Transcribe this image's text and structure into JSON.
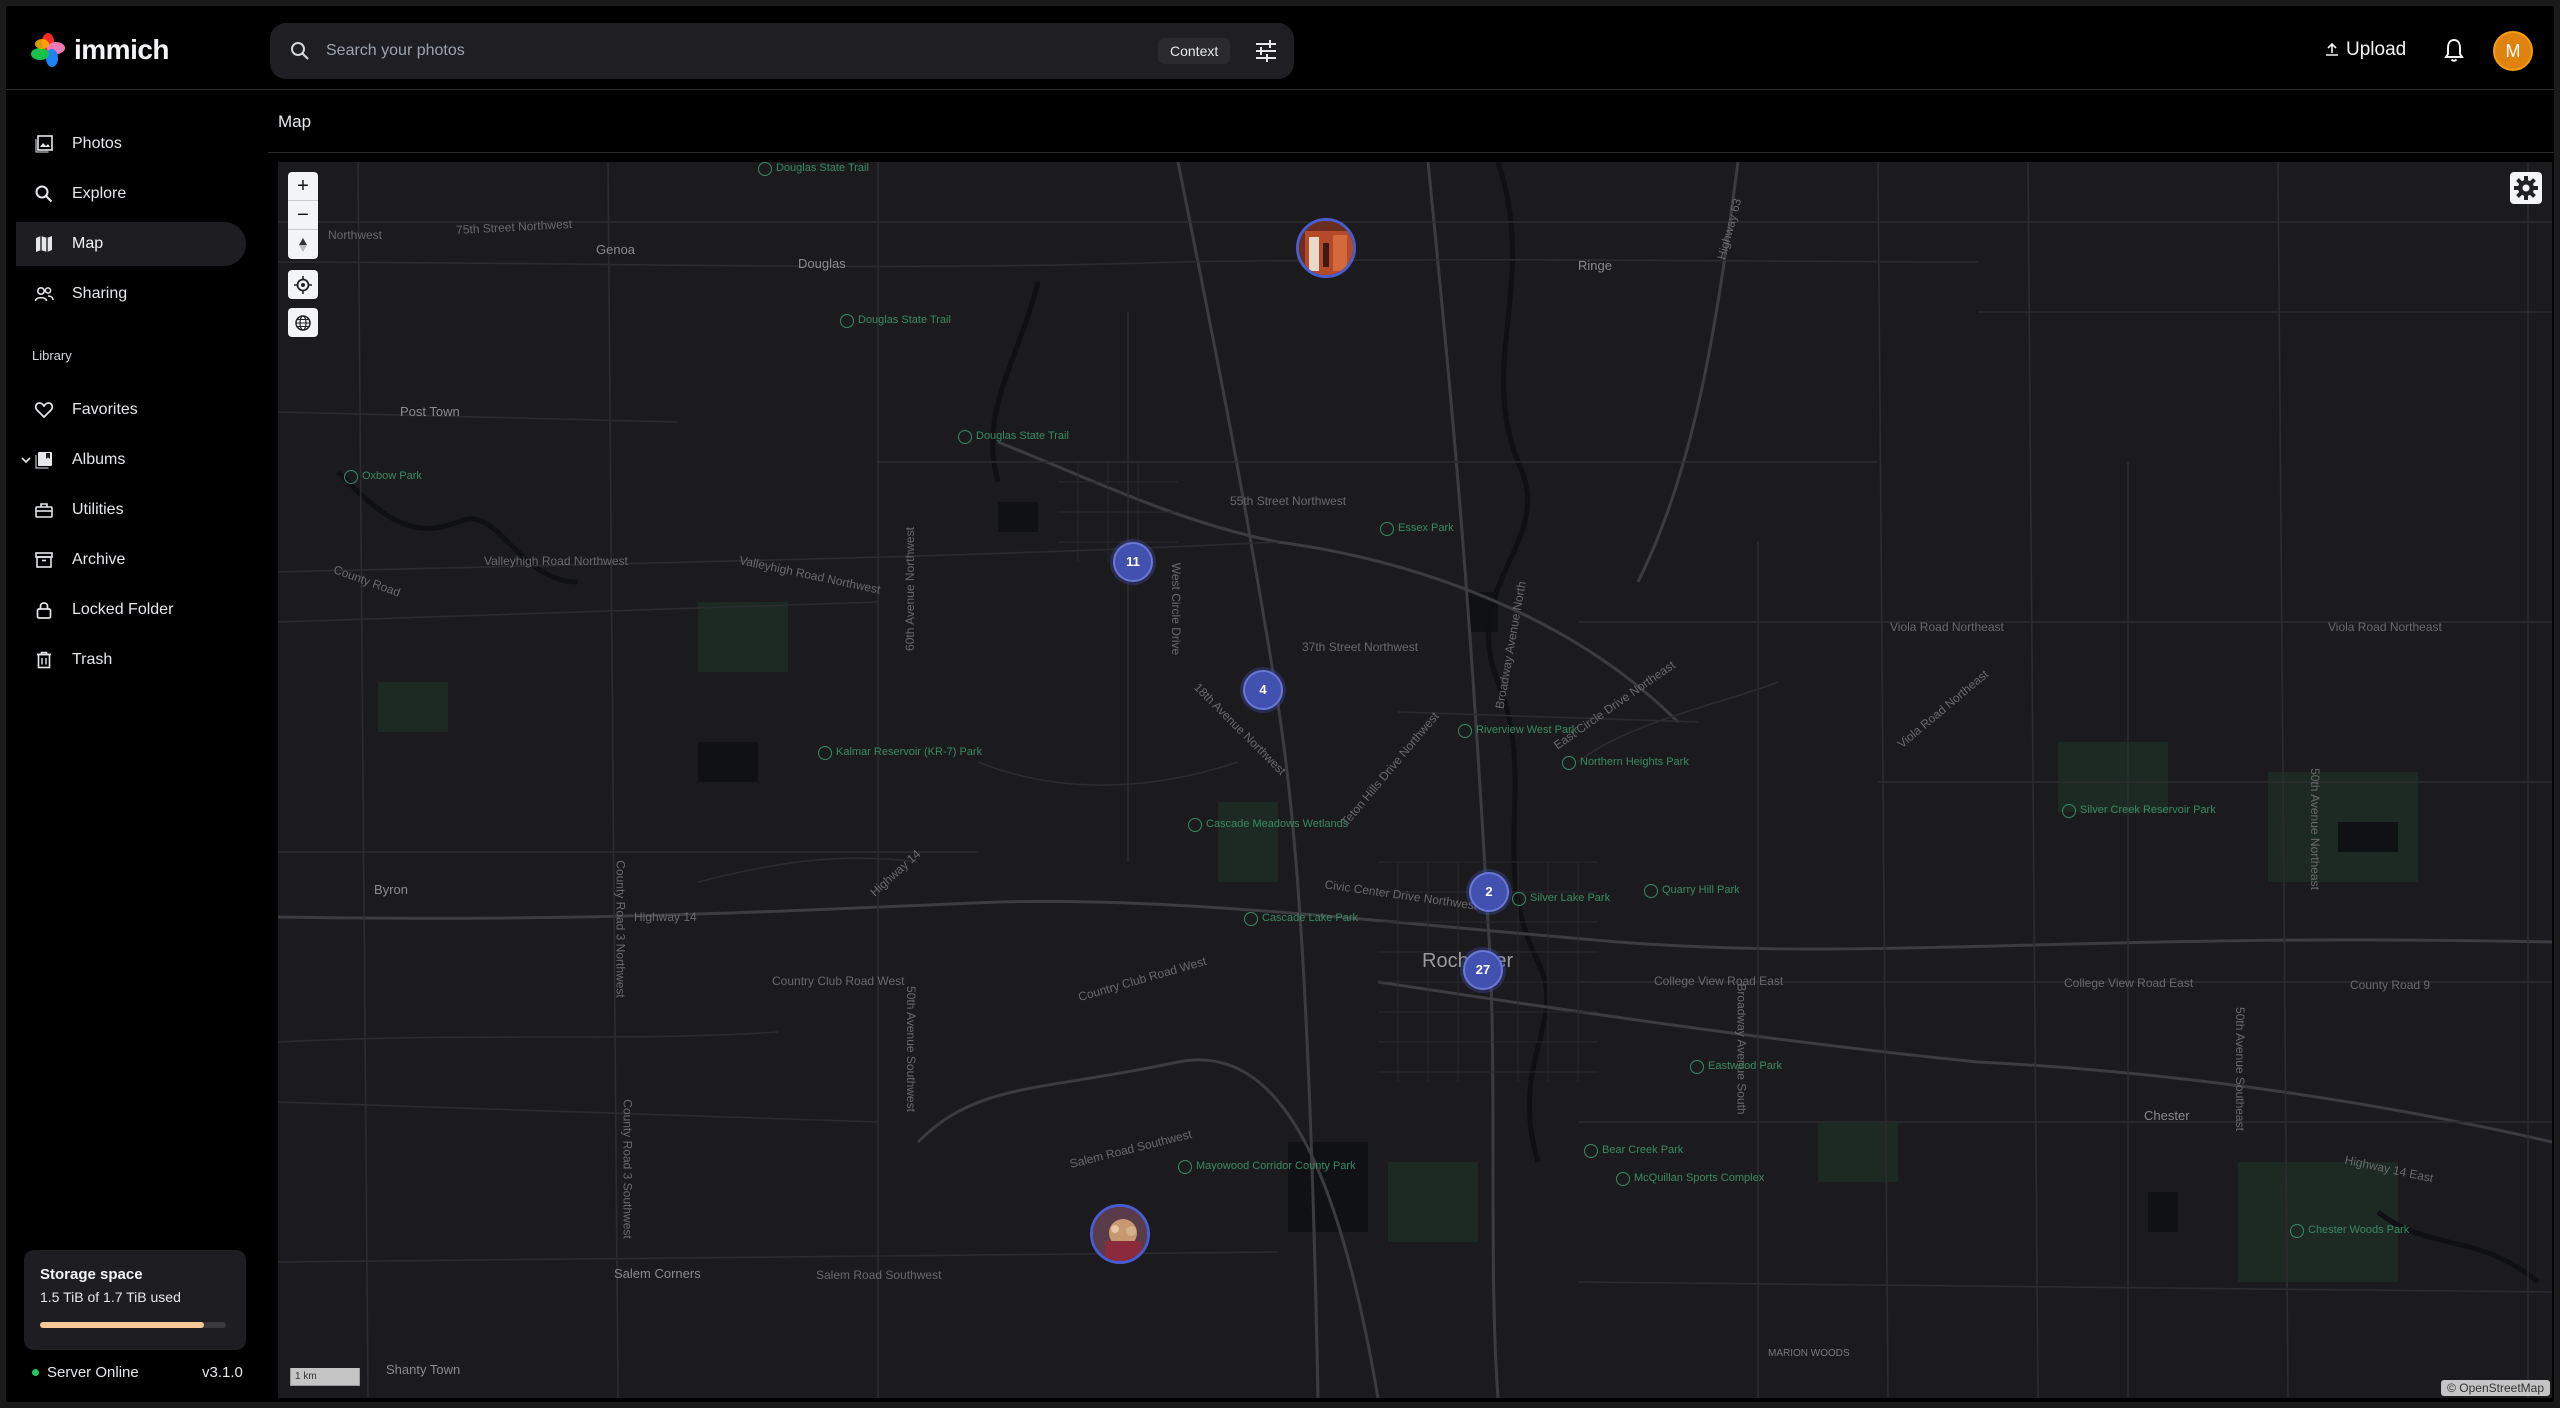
{
  "app": {
    "name": "immich"
  },
  "header": {
    "search_placeholder": "Search your photos",
    "context_chip": "Context",
    "upload_label": "Upload",
    "avatar_initial": "M"
  },
  "sidebar": {
    "items": [
      {
        "label": "Photos",
        "icon": "photos-icon"
      },
      {
        "label": "Explore",
        "icon": "search-icon"
      },
      {
        "label": "Map",
        "icon": "map-icon",
        "active": true
      },
      {
        "label": "Sharing",
        "icon": "people-icon"
      }
    ],
    "library_label": "Library",
    "library_items": [
      {
        "label": "Favorites",
        "icon": "heart-icon"
      },
      {
        "label": "Albums",
        "icon": "album-icon"
      },
      {
        "label": "Utilities",
        "icon": "toolbox-icon"
      },
      {
        "label": "Archive",
        "icon": "archive-icon"
      },
      {
        "label": "Locked Folder",
        "icon": "lock-icon"
      },
      {
        "label": "Trash",
        "icon": "trash-icon"
      }
    ],
    "storage": {
      "title": "Storage space",
      "used": "1.5 TiB of 1.7 TiB used",
      "fraction": 0.88
    },
    "server_status": "Server Online",
    "version": "v3.1.0"
  },
  "page": {
    "title": "Map"
  },
  "map": {
    "clusters": [
      "11",
      "4",
      "2",
      "27"
    ],
    "scale_label": "1 km",
    "attribution": "© OpenStreetMap",
    "places": {
      "genoa": "Genoa",
      "douglas": "Douglas",
      "ringe": "Ringe",
      "post_town": "Post Town",
      "byron": "Byron",
      "rochester": "Rochester",
      "chester": "Chester",
      "salem_corners": "Salem Corners",
      "shanty_town": "Shanty Town",
      "marion_woods": "MARION WOODS"
    },
    "roads": {
      "r75": "75th Street Northwest",
      "r55": "55th Street Northwest",
      "r37": "37th Street Northwest",
      "valleyhigh": "Valleyhigh Road Northwest",
      "valleyhigh2": "Valleyhigh Road Northwest",
      "county_road": "County Road",
      "hwy14": "Highway 14",
      "hwy14b": "Highway 14",
      "country_club": "Country Club Road West",
      "country_club2": "Country Club Road West",
      "salem": "Salem Road Southwest",
      "salem2": "Salem Road Southwest",
      "cvr": "College View Road East",
      "cvr2": "College View Road East",
      "viola": "Viola Road Northeast",
      "viola2": "Viola Road Northeast",
      "viola3": "Viola Road Northeast",
      "county9": "County Road 9",
      "hwy14e": "Highway 14 East",
      "ecircle": "East Circle Drive Northeast",
      "civic": "Civic Center Drive Northwest",
      "teton": "Teton Hills Drive Northwest",
      "hwy63": "Highway 63",
      "cr3": "County Road 3 Northwest",
      "cr3s": "County Road 3 Southwest",
      "ave60": "60th Avenue Northwest",
      "ave50": "50th Avenue Northeast",
      "ave50s": "50th Avenue Southeast",
      "ave50sw": "50th Avenue Southwest",
      "westcircle": "West Circle Drive",
      "broadway": "Broadway Avenue North",
      "broadways": "Broadway Avenue South",
      "ave18": "18th Avenue Northwest",
      "nw": "Northwest",
      "county_road_w": "County Road 3 Northwest"
    },
    "parks": {
      "douglas1": "Douglas State Trail",
      "douglas2": "Douglas State Trail",
      "douglas3": "Douglas State Trail",
      "oxbow": "Oxbow Park",
      "essex": "Essex Park",
      "kalmar": "Kalmar Reservoir (KR-7) Park",
      "riverview": "Riverview West Park",
      "northern": "Northern Heights Park",
      "cascade_meadows": "Cascade Meadows Wetlands",
      "cascade_lake": "Cascade Lake Park",
      "silver_lake": "Silver Lake Park",
      "quarry": "Quarry Hill Park",
      "silver_creek": "Silver Creek Reservoir Park",
      "eastwood": "Eastwood Park",
      "bear_creek": "Bear Creek Park",
      "mcquillan": "McQuillan Sports Complex",
      "mayowood": "Mayowood Corridor County Park",
      "chester_woods": "Chester Woods Park"
    }
  },
  "colors": {
    "accent": "#4250af",
    "avatar": "#e0820f",
    "storage_fill": "#f6c89a",
    "status": "#22c55e"
  }
}
